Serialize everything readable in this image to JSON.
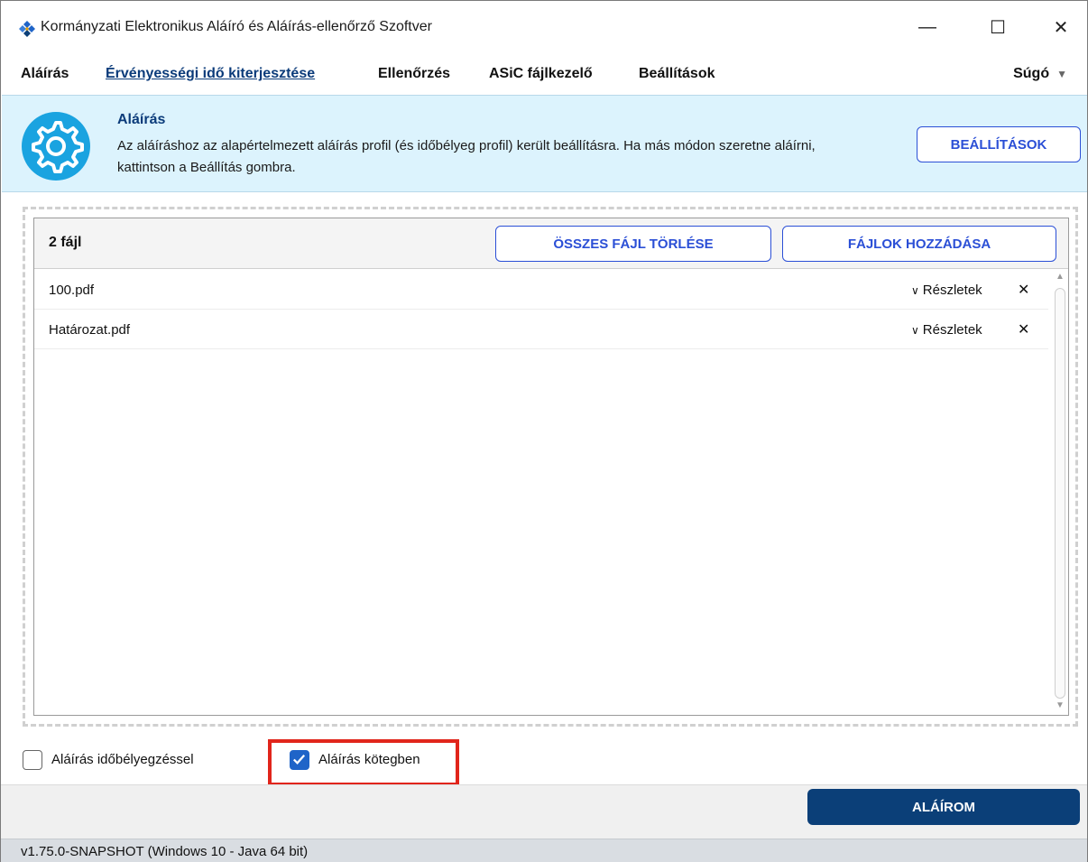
{
  "window": {
    "title": "Kormányzati Elektronikus Aláíró és Aláírás-ellenőrző Szoftver",
    "minimize_glyph": "—",
    "maximize_glyph": "☐",
    "close_glyph": "✕"
  },
  "menu": {
    "items": [
      {
        "label": "Aláírás"
      },
      {
        "label": "Érvényességi idő kiterjesztése",
        "active": true
      },
      {
        "label": "Ellenőrzés"
      },
      {
        "label": "ASiC fájlkezelő"
      },
      {
        "label": "Beállítások"
      }
    ],
    "help": "Súgó"
  },
  "banner": {
    "icon": "gear-icon",
    "title": "Aláírás",
    "text": "Az aláíráshoz az alapértelmezett aláírás profil (és időbélyeg profil) került beállításra. Ha más módon szeretne aláírni, kattintson a Beállítás gombra.",
    "button": "BEÁLLÍTÁSOK"
  },
  "files": {
    "count_label": "2 fájl",
    "clear_all_button": "ÖSSZES FÁJL TÖRLÉSE",
    "add_files_button": "FÁJLOK HOZZÁDÁSA",
    "details_label": "Részletek",
    "items": [
      {
        "name": "100.pdf"
      },
      {
        "name": "Határozat.pdf"
      }
    ]
  },
  "options": {
    "timestamp": {
      "label": "Aláírás időbélyegzéssel",
      "checked": false
    },
    "batch": {
      "label": "Aláírás kötegben",
      "checked": true
    }
  },
  "actions": {
    "sign_button": "ALÁÍROM"
  },
  "status": {
    "version": "v1.75.0-SNAPSHOT (Windows 10 - Java 64 bit)"
  },
  "colors": {
    "accent": "#2b4fd6",
    "primary_dark": "#0b3f78",
    "banner_bg": "#dcf3fd",
    "highlight": "#e1251b",
    "gear_cyan": "#1aa3e0"
  }
}
